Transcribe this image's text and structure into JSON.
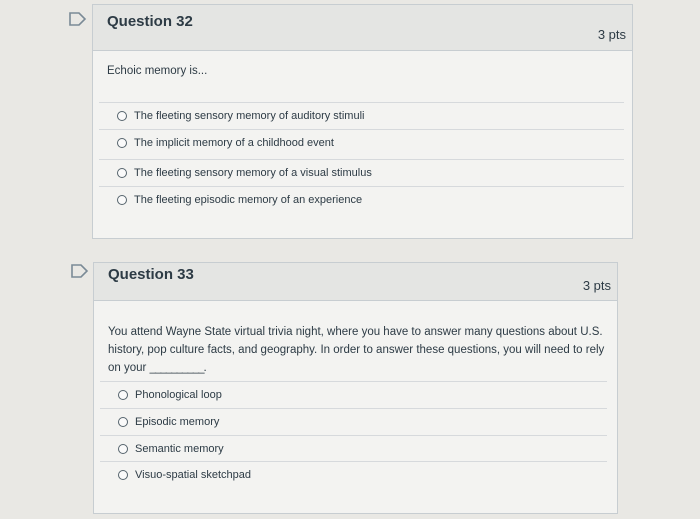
{
  "questions": [
    {
      "title": "Question 32",
      "points": "3 pts",
      "prompt": "Echoic memory is...",
      "answers": [
        "The fleeting sensory memory of auditory stimuli",
        "The implicit memory of a childhood event",
        "The fleeting sensory memory of a visual stimulus",
        "The fleeting episodic memory of an experience"
      ]
    },
    {
      "title": "Question 33",
      "points": "3 pts",
      "prompt_line1": "You attend Wayne State virtual trivia night, where you have to answer many questions about U.S.",
      "prompt_line2": "history, pop culture facts, and geography. In order to answer these questions, you will need to rely",
      "prompt_line3": "on your",
      "prompt_blank": "__________",
      "prompt_end": ".",
      "answers": [
        "Phonological loop",
        "Episodic memory",
        "Semantic memory",
        "Visuo-spatial sketchpad"
      ]
    }
  ],
  "colors": {
    "flag": "#7a8a96",
    "background": "#e9e8e4",
    "header": "#e4e5e3"
  }
}
